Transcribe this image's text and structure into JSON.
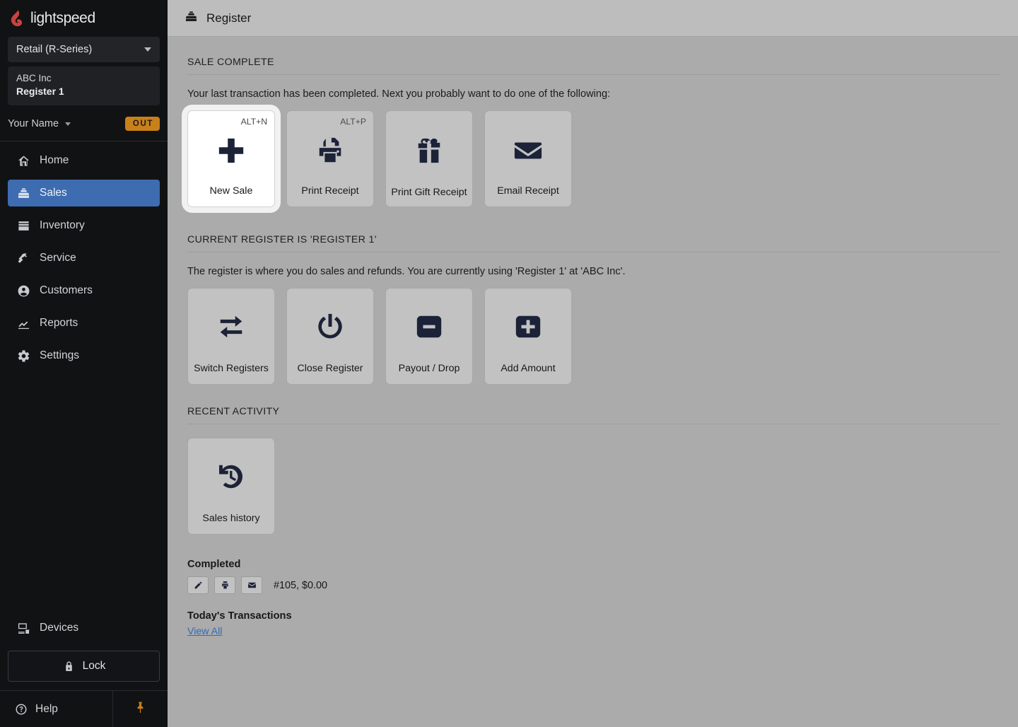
{
  "brand": {
    "name": "lightspeed",
    "logo_color": "#c8433e"
  },
  "sidebar": {
    "product_select": {
      "value": "Retail (R-Series)",
      "icon": "chevron-down-icon"
    },
    "store": {
      "name": "ABC Inc",
      "register": "Register 1"
    },
    "user": {
      "name": "Your Name",
      "status_badge": "OUT",
      "badge_color": "#c8801a"
    },
    "nav_items": [
      {
        "label": "Home",
        "icon": "home-icon",
        "active": false
      },
      {
        "label": "Sales",
        "icon": "register-icon",
        "active": true
      },
      {
        "label": "Inventory",
        "icon": "inventory-box-icon",
        "active": false
      },
      {
        "label": "Service",
        "icon": "hammer-icon",
        "active": false
      },
      {
        "label": "Customers",
        "icon": "person-circle-icon",
        "active": false
      },
      {
        "label": "Reports",
        "icon": "chart-line-icon",
        "active": false
      },
      {
        "label": "Settings",
        "icon": "gear-icon",
        "active": false
      }
    ],
    "devices": {
      "label": "Devices",
      "icon": "monitor-icon"
    },
    "lock": {
      "label": "Lock",
      "icon": "lock-icon"
    },
    "help": {
      "label": "Help",
      "icon": "question-circle-icon"
    },
    "pin": {
      "icon": "pushpin-icon",
      "color": "#c8801a"
    },
    "active_color": "#3d6cb0"
  },
  "topbar": {
    "title": "Register",
    "icon": "register-icon"
  },
  "sections": {
    "sale_complete": {
      "heading": "SALE COMPLETE",
      "description": "Your last transaction has been completed. Next you probably want to do one of the following:",
      "tiles": [
        {
          "label": "New Sale",
          "hotkey": "ALT+N",
          "icon": "plus-icon",
          "focused": true
        },
        {
          "label": "Print Receipt",
          "hotkey": "ALT+P",
          "icon": "printer-icon",
          "focused": false
        },
        {
          "label": "Print Gift Receipt",
          "hotkey": "",
          "icon": "gift-icon",
          "focused": false
        },
        {
          "label": "Email Receipt",
          "hotkey": "",
          "icon": "envelope-icon",
          "focused": false
        }
      ]
    },
    "current_register": {
      "heading": "CURRENT REGISTER IS 'REGISTER 1'",
      "description": "The register is where you do sales and refunds. You are currently using 'Register 1'  at 'ABC Inc'.",
      "tiles": [
        {
          "label": "Switch Registers",
          "icon": "swap-arrows-icon"
        },
        {
          "label": "Close Register",
          "icon": "power-icon"
        },
        {
          "label": "Payout / Drop",
          "icon": "minus-square-icon"
        },
        {
          "label": "Add Amount",
          "icon": "plus-square-icon"
        }
      ]
    },
    "recent_activity": {
      "heading": "RECENT ACTIVITY",
      "tiles": [
        {
          "label": "Sales history",
          "icon": "history-clock-icon"
        }
      ],
      "completed": {
        "title": "Completed",
        "actions": [
          {
            "icon": "pencil-icon",
            "name": "edit"
          },
          {
            "icon": "printer-icon",
            "name": "print"
          },
          {
            "icon": "envelope-icon",
            "name": "email"
          }
        ],
        "summary": "#105, $0.00"
      },
      "today": {
        "title": "Today's Transactions",
        "link": "View All"
      }
    }
  }
}
